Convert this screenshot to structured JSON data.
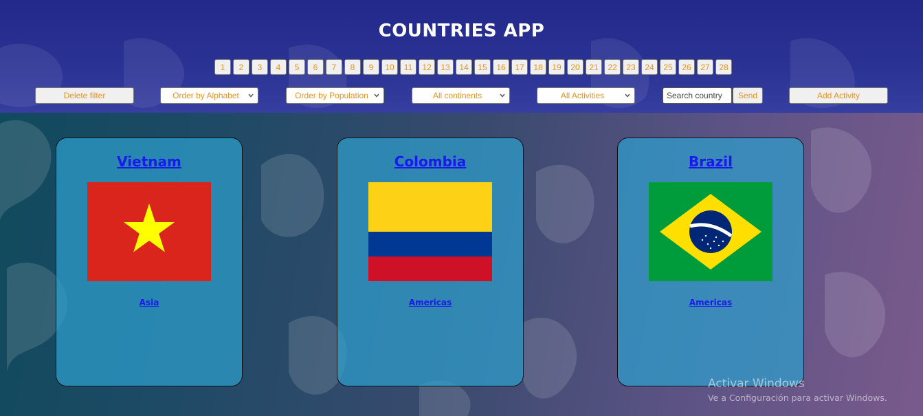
{
  "app": {
    "title": "COUNTRIES APP"
  },
  "pagination": {
    "pages": [
      "1",
      "2",
      "3",
      "4",
      "5",
      "6",
      "7",
      "8",
      "9",
      "10",
      "11",
      "12",
      "13",
      "14",
      "15",
      "16",
      "17",
      "18",
      "19",
      "20",
      "21",
      "22",
      "23",
      "24",
      "25",
      "26",
      "27",
      "28"
    ]
  },
  "controls": {
    "delete_filter": "Delete filter",
    "order_alphabet": "Order by Alphabet",
    "order_population": "Order by Population",
    "continents": "All continents",
    "activities": "All Activities",
    "search_placeholder": "Search country",
    "send": "Send",
    "add_activity": "Add Activity"
  },
  "cards": [
    {
      "name": "Vietnam",
      "continent": "Asia",
      "flag_icon": "vietnam-flag-icon"
    },
    {
      "name": "Colombia",
      "continent": "Americas",
      "flag_icon": "colombia-flag-icon"
    },
    {
      "name": "Brazil",
      "continent": "Americas",
      "flag_icon": "brazil-flag-icon"
    }
  ],
  "watermark": {
    "title": "Activar Windows",
    "subtitle": "Ve a Configuración para activar Windows."
  },
  "colors": {
    "header_bg": "#2a3294",
    "button_text": "#e8941f",
    "card_bg": "#2ea0cd",
    "link": "#1a1aee"
  }
}
